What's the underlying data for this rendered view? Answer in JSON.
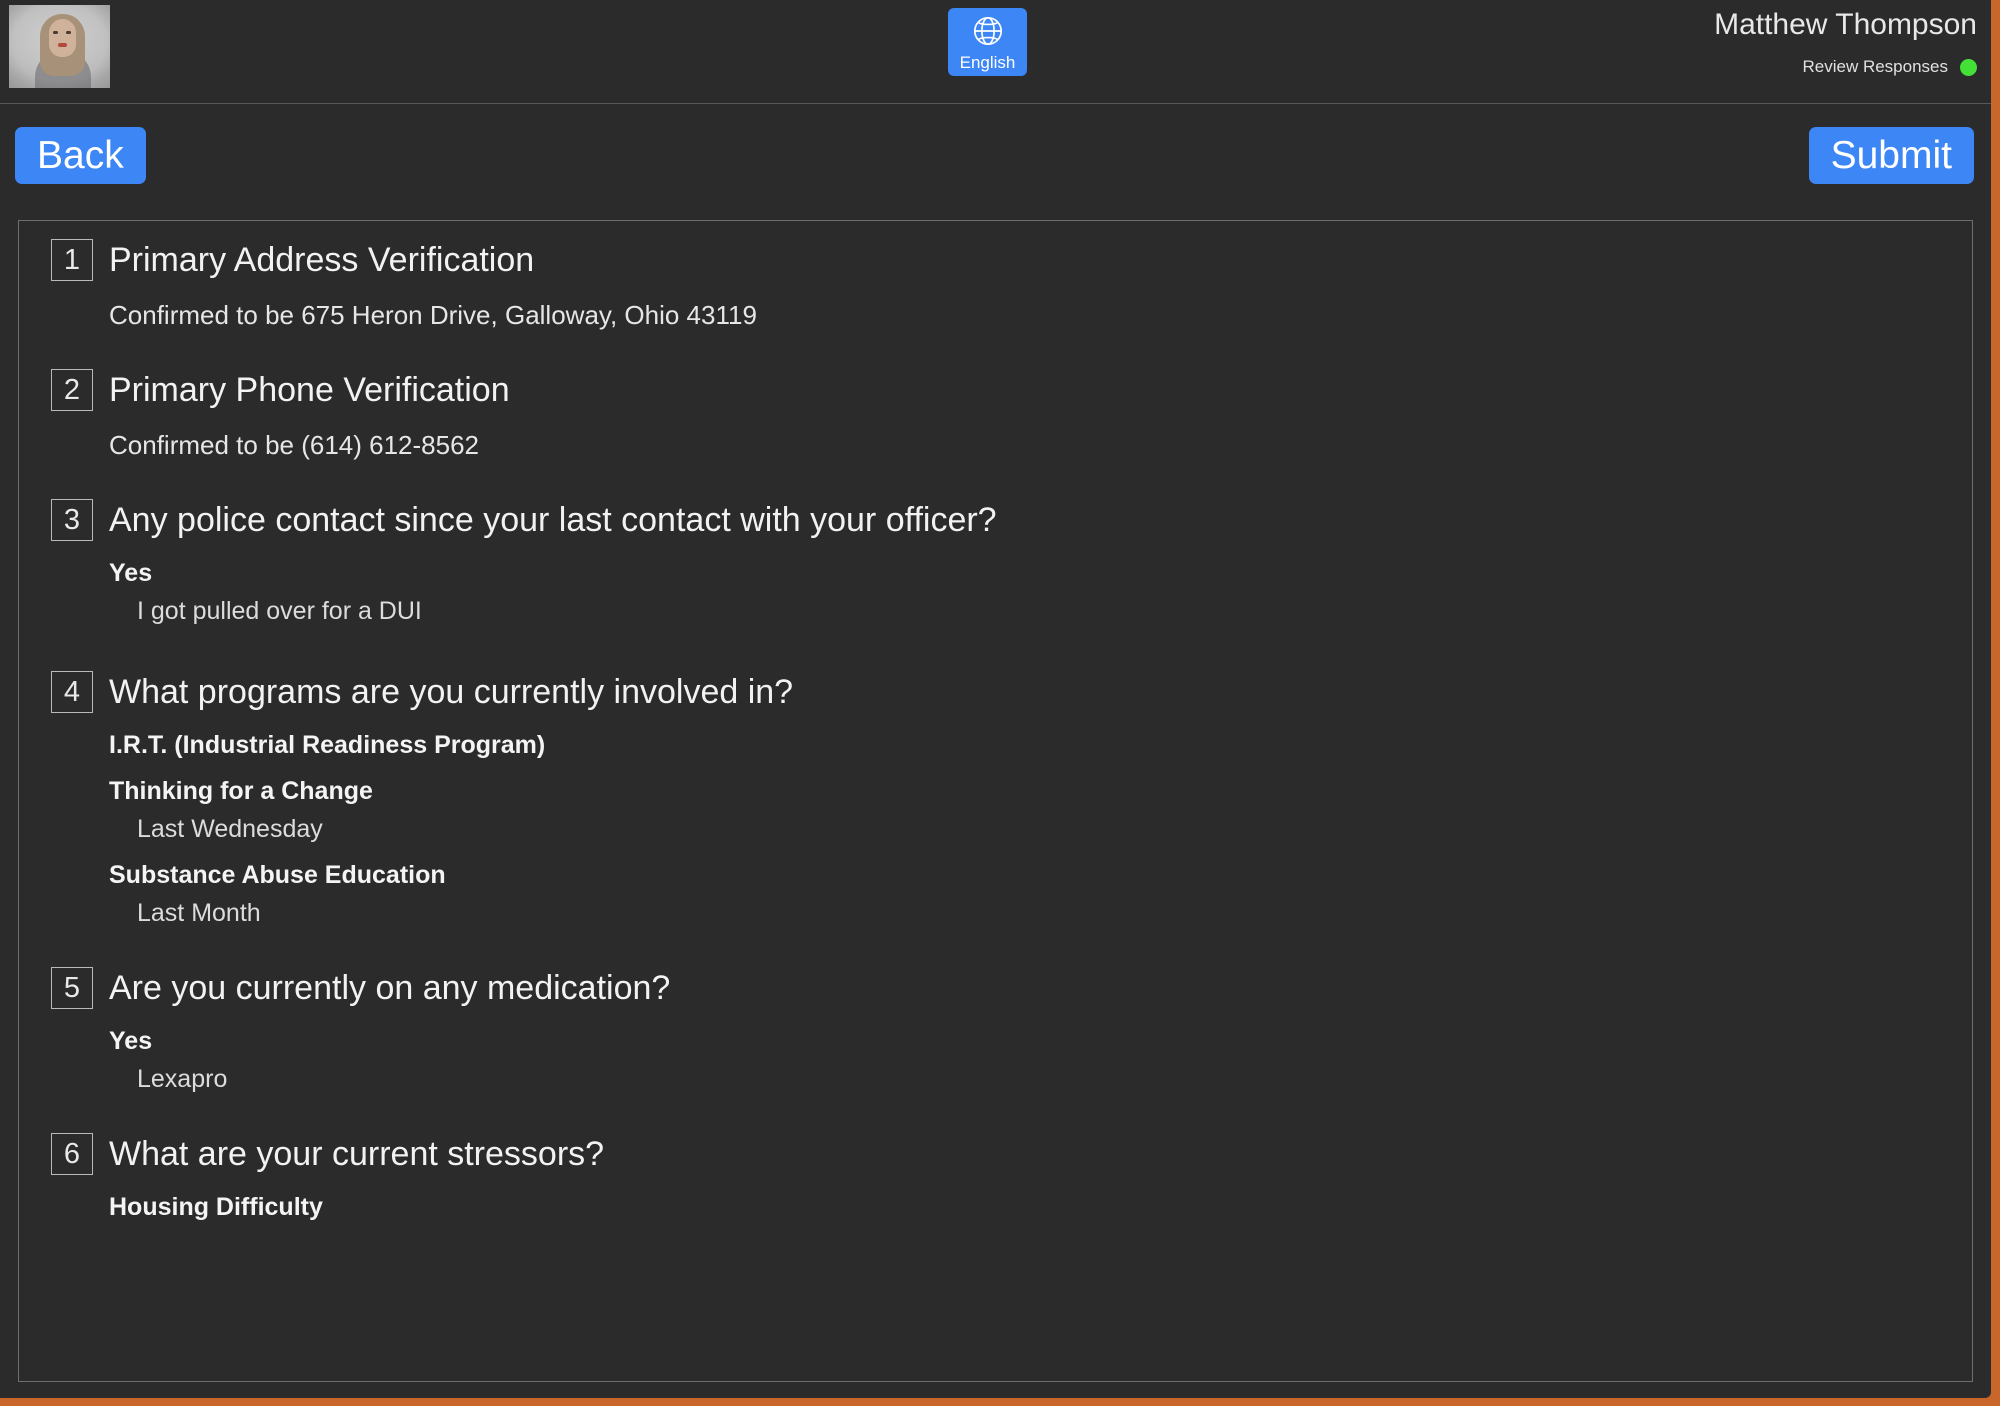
{
  "header": {
    "video_thumbnail_name": "participant-video-feed",
    "language_button": {
      "icon": "globe-icon",
      "label": "English"
    },
    "user_name": "Matthew Thompson",
    "review_status_label": "Review Responses",
    "review_status_color": "#44e038"
  },
  "action_bar": {
    "back_label": "Back",
    "submit_label": "Submit",
    "accent_color": "#3d86f5"
  },
  "questions": [
    {
      "number": "1",
      "title": "Primary Address Verification",
      "plain_answer": "Confirmed to be 675 Heron Drive, Galloway, Ohio 43119",
      "answers": []
    },
    {
      "number": "2",
      "title": "Primary Phone Verification",
      "plain_answer": "Confirmed to be (614) 612-8562",
      "answers": []
    },
    {
      "number": "3",
      "title": "Any police contact since your last contact with your officer?",
      "plain_answer": null,
      "answers": [
        {
          "label": "Yes",
          "detail": "I got pulled over for a DUI"
        }
      ]
    },
    {
      "number": "4",
      "title": "What programs are you currently involved in?",
      "plain_answer": null,
      "answers": [
        {
          "label": "I.R.T. (Industrial Readiness Program)",
          "detail": null
        },
        {
          "label": "Thinking for a Change",
          "detail": "Last Wednesday"
        },
        {
          "label": "Substance Abuse Education",
          "detail": "Last Month"
        }
      ]
    },
    {
      "number": "5",
      "title": "Are you currently on any medication?",
      "plain_answer": null,
      "answers": [
        {
          "label": "Yes",
          "detail": "Lexapro"
        }
      ]
    },
    {
      "number": "6",
      "title": "What are your current stressors?",
      "plain_answer": null,
      "answers": [
        {
          "label": "Housing Difficulty",
          "detail": null
        }
      ]
    }
  ]
}
